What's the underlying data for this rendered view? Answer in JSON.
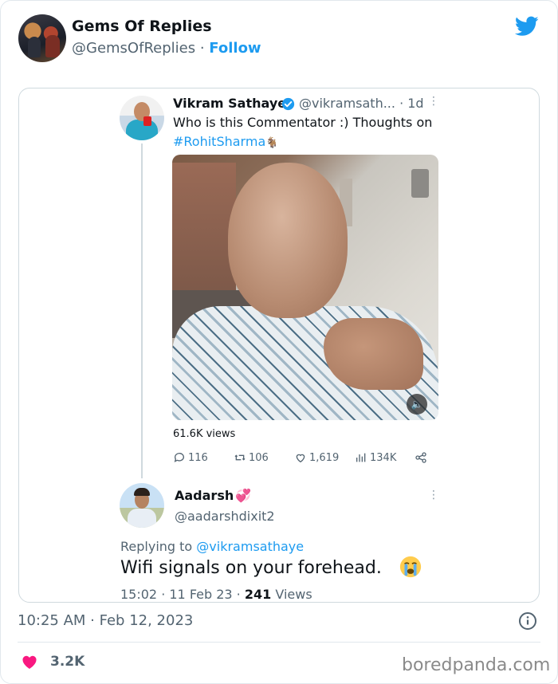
{
  "header": {
    "name": "Gems Of Replies",
    "handle": "@GemsOfReplies",
    "separator": "·",
    "follow_label": "Follow",
    "icon": "twitter-bird-icon"
  },
  "quoted_tweet": {
    "author_name": "Vikram Sathaye",
    "author_handle": "@vikramsath...",
    "time_separator": "·",
    "time_ago": "1d",
    "more": "⋮",
    "text": "Who is this Commentator :) Thoughts on",
    "hashtag": "#RohitSharma",
    "hashtag_icon": "🐐",
    "views": "61.6K views",
    "stats": {
      "replies": "116",
      "retweets": "106",
      "likes": "1,619",
      "analytics": "134K"
    }
  },
  "reply": {
    "author_name": "Aadarsh",
    "author_emoji": "💞",
    "author_handle": "@aadarshdixit2",
    "more": "⋮",
    "replying_prefix": "Replying to",
    "replying_to": "@vikramsathaye",
    "text": "Wifi signals on your forehead.",
    "emoji": "crying-face-icon",
    "timestamp": "15:02 · 11 Feb 23 ·",
    "views_count": "241",
    "views_label": "Views"
  },
  "footer": {
    "timestamp": "10:25 AM · Feb 12, 2023",
    "likes": "3.2K",
    "watermark": "boredpanda.com"
  },
  "colors": {
    "accent": "#1d9bf0",
    "heart": "#f91880",
    "text_secondary": "#536471"
  }
}
